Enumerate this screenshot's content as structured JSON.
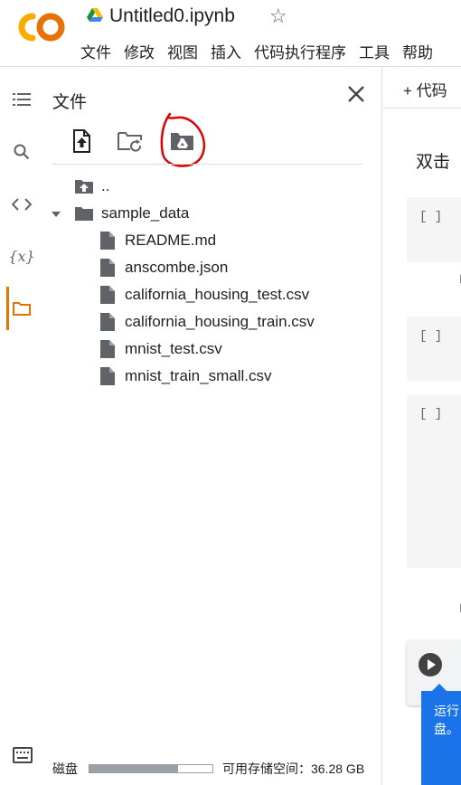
{
  "header": {
    "title": "Untitled0.ipynb",
    "logo_text": "CO",
    "menu": [
      "文件",
      "修改",
      "视图",
      "插入",
      "代码执行程序",
      "工具",
      "帮助"
    ]
  },
  "rail": {
    "items": [
      "table-of-contents",
      "search",
      "code-snippets",
      "variables",
      "files"
    ],
    "active": "files"
  },
  "files_panel": {
    "title": "文件",
    "toolbar": [
      "upload-file",
      "refresh",
      "mount-drive"
    ],
    "tree": [
      {
        "label": "..",
        "type": "parent"
      },
      {
        "label": "sample_data",
        "type": "folder",
        "expanded": true
      },
      {
        "label": "README.md",
        "type": "file"
      },
      {
        "label": "anscombe.json",
        "type": "file"
      },
      {
        "label": "california_housing_test.csv",
        "type": "file"
      },
      {
        "label": "california_housing_train.csv",
        "type": "file"
      },
      {
        "label": "mnist_test.csv",
        "type": "file"
      },
      {
        "label": "mnist_train_small.csv",
        "type": "file"
      }
    ],
    "disk_label": "磁盘",
    "disk_used_fraction": 0.72,
    "disk_available": "可用存储空间：36.28 GB"
  },
  "notebook": {
    "add_code_label": "+ 代码",
    "intro_text": "双击",
    "cell_bracket": "[ ]",
    "tooltip_line1": "运行",
    "tooltip_line2": "盘。"
  },
  "colors": {
    "accent_orange": "#e37400",
    "logo_orange": "#f9ab00",
    "annotation_red": "#e00000",
    "tooltip_blue": "#1a73e8"
  }
}
